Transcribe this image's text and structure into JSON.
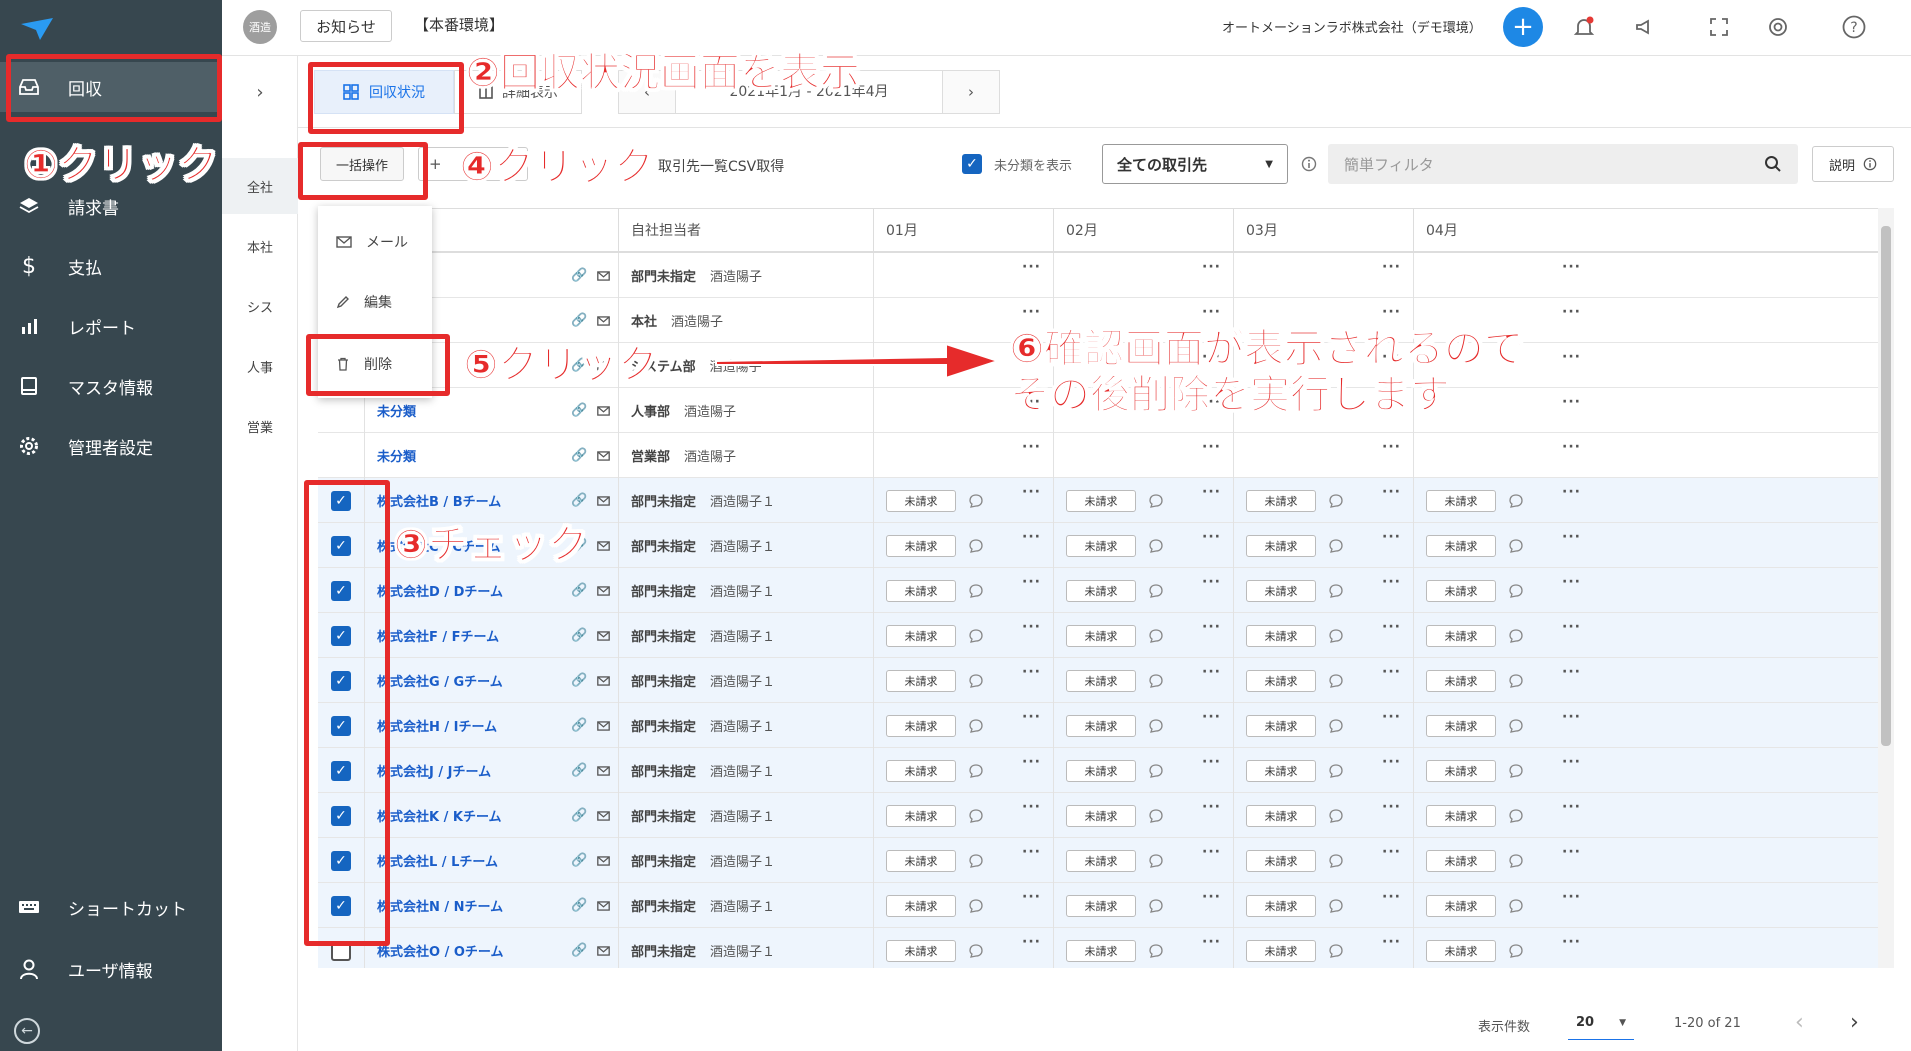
{
  "sidebar": {
    "items": [
      {
        "label": "回収",
        "icon": "inbox-icon",
        "name": "sidebar-item-collection"
      },
      {
        "label": "請求書",
        "icon": "layers-icon",
        "name": "sidebar-item-invoice"
      },
      {
        "label": "支払",
        "icon": "dollar-icon",
        "name": "sidebar-item-payment"
      },
      {
        "label": "レポート",
        "icon": "bar-chart-icon",
        "name": "sidebar-item-report"
      },
      {
        "label": "マスタ情報",
        "icon": "book-icon",
        "name": "sidebar-item-master"
      },
      {
        "label": "管理者設定",
        "icon": "gear-icon",
        "name": "sidebar-item-admin"
      }
    ],
    "bottom": [
      {
        "label": "ショートカット",
        "icon": "keyboard-icon"
      },
      {
        "label": "ユーザ情報",
        "icon": "user-icon"
      }
    ]
  },
  "topbar": {
    "chip": "酒造",
    "notice": "お知らせ",
    "env": "【本番環境】",
    "company": "オートメーションラボ株式会社（デモ環境）"
  },
  "depts": [
    "全社",
    "本社",
    "シス",
    "人事",
    "営業"
  ],
  "toolbar": {
    "tab_status": "回収状況",
    "tab_detail": "詳細表示",
    "period": "2021年1月 - 2021年4月",
    "bulk": "一括操作",
    "csv": "取引先一覧CSV取得",
    "show_unclassified": "未分類を表示",
    "partner_select": "全ての取引先",
    "filter_placeholder": "簡単フィルタ",
    "explain": "説明"
  },
  "menu": [
    "メール",
    "編集",
    "削除"
  ],
  "table": {
    "headers": [
      "自社担当者",
      "01月",
      "02月",
      "03月",
      "04月"
    ],
    "rows": [
      {
        "name": "",
        "dept": "部門未指定",
        "person": "酒造陽子",
        "checked": false,
        "status": ""
      },
      {
        "name": "",
        "dept": "本社",
        "person": "酒造陽子",
        "checked": false,
        "status": ""
      },
      {
        "name": "",
        "dept": "システム部",
        "person": "酒造陽子",
        "checked": false,
        "status": ""
      },
      {
        "name": "未分類",
        "dept": "人事部",
        "person": "酒造陽子",
        "checked": false,
        "status": ""
      },
      {
        "name": "未分類",
        "dept": "営業部",
        "person": "酒造陽子",
        "checked": false,
        "status": ""
      },
      {
        "name": "株式会社B / Bチーム",
        "dept": "部門未指定",
        "person": "酒造陽子１",
        "checked": true,
        "status": "未請求"
      },
      {
        "name": "株式会社C / Cチーム",
        "dept": "部門未指定",
        "person": "酒造陽子１",
        "checked": true,
        "status": "未請求"
      },
      {
        "name": "株式会社D / Dチーム",
        "dept": "部門未指定",
        "person": "酒造陽子１",
        "checked": true,
        "status": "未請求"
      },
      {
        "name": "株式会社F / Fチーム",
        "dept": "部門未指定",
        "person": "酒造陽子１",
        "checked": true,
        "status": "未請求"
      },
      {
        "name": "株式会社G / Gチーム",
        "dept": "部門未指定",
        "person": "酒造陽子１",
        "checked": true,
        "status": "未請求"
      },
      {
        "name": "株式会社H / Iチーム",
        "dept": "部門未指定",
        "person": "酒造陽子１",
        "checked": true,
        "status": "未請求"
      },
      {
        "name": "株式会社J / Jチーム",
        "dept": "部門未指定",
        "person": "酒造陽子１",
        "checked": true,
        "status": "未請求"
      },
      {
        "name": "株式会社K / Kチーム",
        "dept": "部門未指定",
        "person": "酒造陽子１",
        "checked": true,
        "status": "未請求"
      },
      {
        "name": "株式会社L / Lチーム",
        "dept": "部門未指定",
        "person": "酒造陽子１",
        "checked": true,
        "status": "未請求"
      },
      {
        "name": "株式会社N / Nチーム",
        "dept": "部門未指定",
        "person": "酒造陽子１",
        "checked": true,
        "status": "未請求"
      },
      {
        "name": "株式会社O / Oチーム",
        "dept": "部門未指定",
        "person": "酒造陽子１",
        "checked": false,
        "status": "未請求"
      }
    ]
  },
  "pager": {
    "label": "表示件数",
    "per_page": "20",
    "range": "1-20 of 21"
  },
  "annotations": {
    "step1": "①クリック",
    "step2": "②回収状況画面を表示",
    "step3": "③チェック",
    "step4": "④クリック",
    "step5": "⑤クリック",
    "step6_line1": "⑥確認画面が表示されるので",
    "step6_line2": "その後削除を実行します。"
  },
  "colors": {
    "sidebar": "#37474f",
    "accent": "#1e88e5",
    "annotation": "#e62b2b",
    "selected_row": "#eef5fd"
  }
}
